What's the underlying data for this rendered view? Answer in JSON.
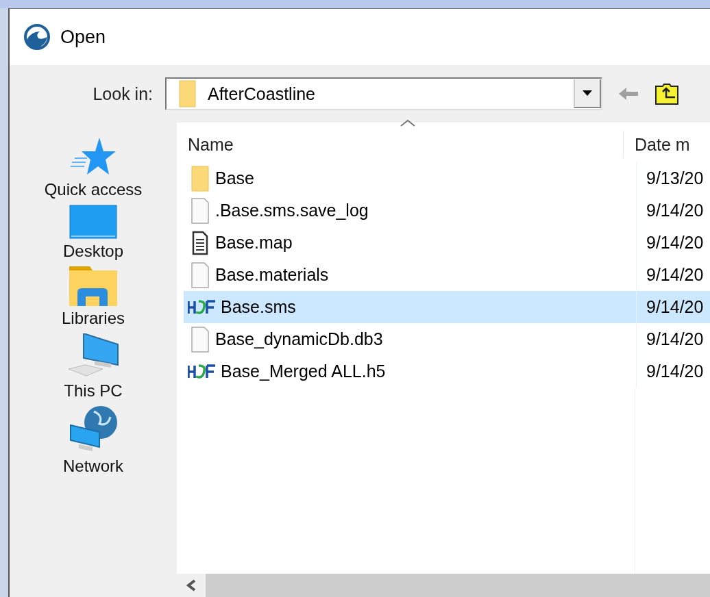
{
  "window": {
    "title": "Open"
  },
  "look_in": {
    "label": "Look in:",
    "value": "AfterCoastline"
  },
  "places": [
    {
      "kind": "star",
      "label": "Quick access"
    },
    {
      "kind": "desktop",
      "label": "Desktop"
    },
    {
      "kind": "libraries",
      "label": "Libraries"
    },
    {
      "kind": "pc",
      "label": "This PC"
    },
    {
      "kind": "network",
      "label": "Network"
    }
  ],
  "table": {
    "columns": [
      "Name",
      "Date m"
    ],
    "rows": [
      {
        "kind": "folder",
        "name": "Base",
        "date": "9/13/20",
        "selected": false
      },
      {
        "kind": "blank",
        "name": ".Base.sms.save_log",
        "date": "9/14/20",
        "selected": false
      },
      {
        "kind": "text",
        "name": "Base.map",
        "date": "9/14/20",
        "selected": false
      },
      {
        "kind": "blank",
        "name": "Base.materials",
        "date": "9/14/20",
        "selected": false
      },
      {
        "kind": "hdf",
        "name": "Base.sms",
        "date": "9/14/20",
        "selected": true
      },
      {
        "kind": "blank",
        "name": "Base_dynamicDb.db3",
        "date": "9/14/20",
        "selected": false
      },
      {
        "kind": "hdf",
        "name": "Base_Merged ALL.h5",
        "date": "9/14/20",
        "selected": false
      }
    ]
  }
}
